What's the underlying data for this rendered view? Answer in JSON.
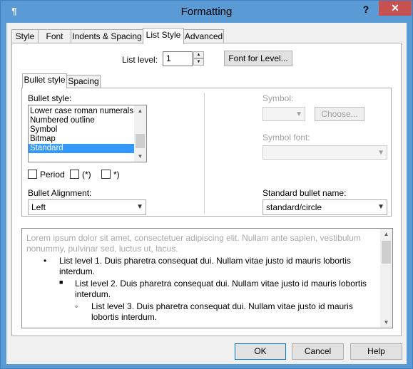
{
  "window": {
    "title": "Formatting",
    "help_glyph": "?",
    "close_glyph": "✕",
    "app_icon_glyph": "¶"
  },
  "tabs": [
    "Style",
    "Font",
    "Indents & Spacing",
    "List Style",
    "Advanced"
  ],
  "list_level": {
    "label": "List level:",
    "value": "1"
  },
  "font_for_level_button": "Font for Level...",
  "subtabs": [
    "Bullet style",
    "Spacing"
  ],
  "bullet_style": {
    "label": "Bullet style:",
    "items": [
      "Lower case roman numerals",
      "Numbered outline",
      "Symbol",
      "Bitmap",
      "Standard"
    ],
    "selected_index": 4
  },
  "checkboxes": [
    {
      "label": "Period",
      "checked": false
    },
    {
      "label": "(*)",
      "checked": false
    },
    {
      "label": "*)",
      "checked": false
    }
  ],
  "bullet_alignment": {
    "label": "Bullet Alignment:",
    "value": "Left"
  },
  "symbol": {
    "label": "Symbol:",
    "choose_button": "Choose..."
  },
  "symbol_font": {
    "label": "Symbol font:"
  },
  "standard_bullet_name": {
    "label": "Standard bullet name:",
    "value": "standard/circle"
  },
  "preview": {
    "lorem": "Lorem ipsum dolor sit amet, consectetuer adipiscing elit. Nullam ante sapien, vestibulum nonummy, pulvinar sed, luctus ut, lacus.",
    "items": [
      {
        "bullet": "•",
        "text": "List level 1. Duis pharetra consequat dui. Nullam vitae justo id mauris lobortis interdum."
      },
      {
        "bullet": "■",
        "text": "List level 2. Duis pharetra consequat dui. Nullam vitae justo id mauris lobortis interdum."
      },
      {
        "bullet": "◦",
        "text": "List level 3. Duis pharetra consequat dui. Nullam vitae justo id mauris lobortis interdum."
      }
    ]
  },
  "buttons": {
    "ok": "OK",
    "cancel": "Cancel",
    "help": "Help"
  },
  "colors": {
    "titlebar": "#5b9bd5",
    "close": "#c75050",
    "selection": "#3399ff"
  }
}
